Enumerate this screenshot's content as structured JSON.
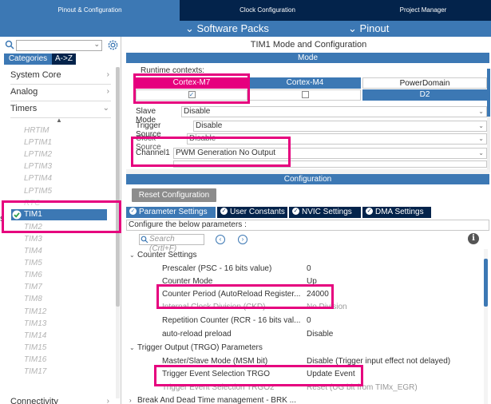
{
  "top_tabs": {
    "pinout": "Pinout & Configuration",
    "clock": "Clock Configuration",
    "project": "Project Manager"
  },
  "secondary_bar": {
    "software_packs": "Software Packs",
    "pinout": "Pinout"
  },
  "left_panel": {
    "categories_tab": "Categories",
    "atoz_tab": "A->Z",
    "categories": {
      "system_core": "System Core",
      "analog": "Analog",
      "timers": "Timers",
      "connectivity": "Connectivity"
    },
    "timers": [
      "HRTIM",
      "LPTIM1",
      "LPTIM2",
      "LPTIM3",
      "LPTIM4",
      "LPTIM5",
      "RTC",
      "TIM1",
      "TIM2",
      "TIM3",
      "TIM4",
      "TIM5",
      "TIM6",
      "TIM7",
      "TIM8",
      "TIM12",
      "TIM13",
      "TIM14",
      "TIM15",
      "TIM16",
      "TIM17"
    ],
    "selected_timer": "TIM1",
    "edge_letter": "s"
  },
  "mode_panel": {
    "title": "TIM1 Mode and Configuration",
    "header": "Mode",
    "runtime_contexts": "Runtime contexts:",
    "contexts": {
      "m7": "Cortex-M7",
      "m4": "Cortex-M4",
      "powerdomain": "PowerDomain",
      "m7_checked": "✓",
      "pd_value": "D2"
    },
    "rows": {
      "slave_mode_label": "Slave Mode",
      "slave_mode_value": "Disable",
      "trigger_source_label": "Trigger Source",
      "trigger_source_value": "Disable",
      "clock_source_label": "Clock Source",
      "clock_source_value": "Disable",
      "channel1_label": "Channel1",
      "channel1_value": "PWM Generation No Output"
    }
  },
  "config_panel": {
    "header": "Configuration",
    "reset_button": "Reset Configuration",
    "tabs": {
      "parameter": "Parameter Settings",
      "user": "User Constants",
      "nvic": "NVIC Settings",
      "dma": "DMA Settings"
    },
    "description": "Configure the below parameters :",
    "search_placeholder": "Search (Crtl+F)",
    "groups": {
      "counter": "Counter Settings",
      "trgo": "Trigger Output (TRGO) Parameters",
      "brk": "Break And Dead Time management - BRK ..."
    },
    "params": {
      "prescaler_name": "Prescaler (PSC - 16 bits value)",
      "prescaler_value": "0",
      "counter_mode_name": "Counter Mode",
      "counter_mode_value": "Up",
      "counter_period_name": "Counter Period (AutoReload Register...",
      "counter_period_value": "24000",
      "clock_div_name": "Internal Clock Division (CKD)",
      "clock_div_value": "No Division",
      "repetition_name": "Repetition Counter (RCR - 16 bits val...",
      "repetition_value": "0",
      "autoreload_name": "auto-reload preload",
      "autoreload_value": "Disable",
      "msm_name": "Master/Slave Mode (MSM bit)",
      "msm_value": "Disable (Trigger input effect not delayed)",
      "trgo_name": "Trigger Event Selection TRGO",
      "trgo_value": "Update Event",
      "trgo2_name": "Trigger Event Selection TRGO2",
      "trgo2_value": "Reset (UG bit from TIMx_EGR)"
    }
  },
  "colors": {
    "accent": "#3c78b4",
    "dark": "#03234b",
    "highlight": "#e6007e"
  }
}
